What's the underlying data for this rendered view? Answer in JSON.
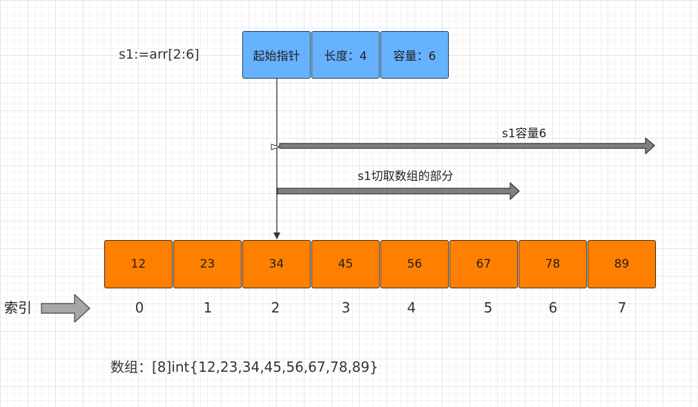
{
  "slice_expr": "s1:=arr[2:6]",
  "header_boxes": [
    {
      "label": "起始指针"
    },
    {
      "label": "长度：4"
    },
    {
      "label": "容量：6"
    }
  ],
  "capacity_label": "s1容量6",
  "cut_label": "s1切取数组的部分",
  "array_cells": [
    "12",
    "23",
    "34",
    "45",
    "56",
    "67",
    "78",
    "89"
  ],
  "index_label": "索引",
  "indices": [
    "0",
    "1",
    "2",
    "3",
    "4",
    "5",
    "6",
    "7"
  ],
  "array_literal": "数组：[8]int{12,23,34,45,56,67,78,89}",
  "colors": {
    "header_fill": "#66b2ff",
    "cell_fill": "#ff8000",
    "arrow_fill": "#808080",
    "index_arrow_fill": "#a6a6a6"
  }
}
